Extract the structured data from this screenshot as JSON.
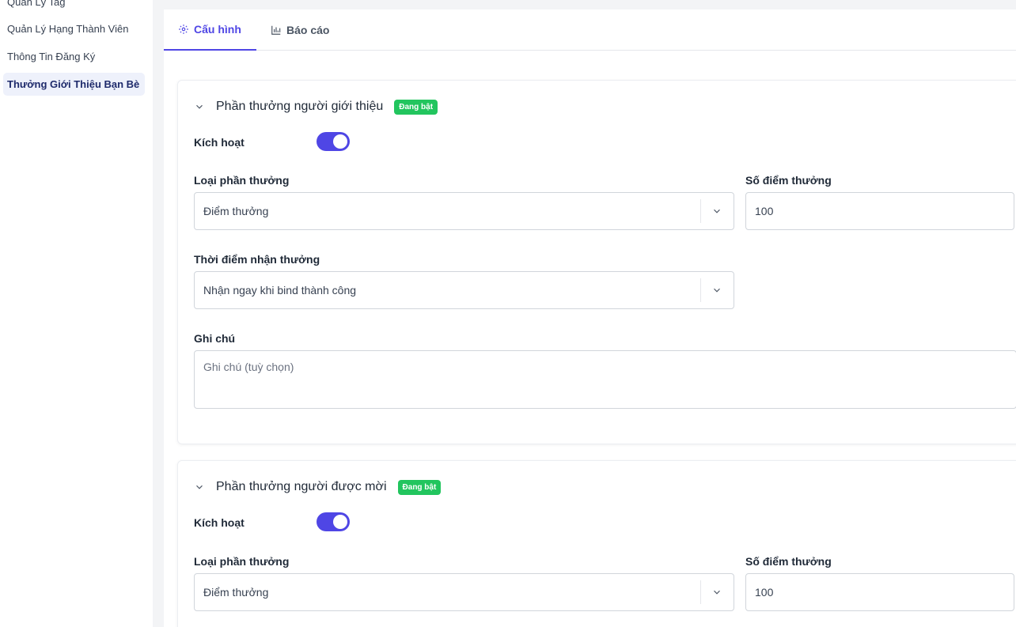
{
  "sidebar": {
    "items": [
      {
        "label": "Quản Lý Tag"
      },
      {
        "label": "Quản Lý Hạng Thành Viên"
      },
      {
        "label": "Thông Tin Đăng Ký"
      },
      {
        "label": "Thưởng Giới Thiệu Bạn Bè",
        "active": true
      }
    ]
  },
  "tabs": [
    {
      "label": "Cấu hình",
      "icon": "gear-icon",
      "active": true
    },
    {
      "label": "Báo cáo",
      "icon": "bar-chart-icon",
      "active": false
    }
  ],
  "cards": [
    {
      "title": "Phần thưởng người giới thiệu",
      "badge": "Đang bật",
      "activate_label": "Kích hoạt",
      "activate_on": true,
      "reward_type_label": "Loại phần thưởng",
      "reward_type_value": "Điểm thưởng",
      "points_label": "Số điểm thưởng",
      "points_value": "100",
      "timing_label": "Thời điểm nhận thưởng",
      "timing_value": "Nhận ngay khi bind thành công",
      "note_label": "Ghi chú",
      "note_placeholder": "Ghi chú (tuỳ chọn)"
    },
    {
      "title": "Phần thưởng người được mời",
      "badge": "Đang bật",
      "activate_label": "Kích hoạt",
      "activate_on": true,
      "reward_type_label": "Loại phần thưởng",
      "reward_type_value": "Điểm thưởng",
      "points_label": "Số điểm thưởng",
      "points_value": "100"
    }
  ],
  "colors": {
    "accent": "#4f46e5",
    "badge": "#22c55e"
  }
}
